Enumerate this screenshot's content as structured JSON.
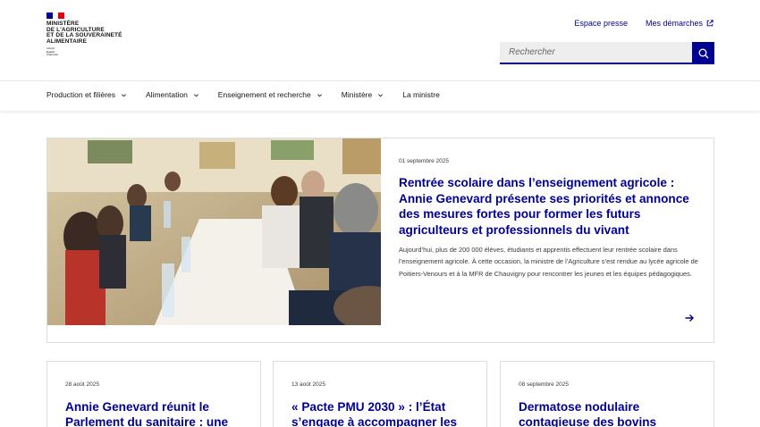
{
  "header": {
    "logo_lines": [
      "Ministère",
      "de l'Agriculture",
      "et de la Souveraineté",
      "alimentaire"
    ],
    "motto": [
      "Liberté",
      "Égalité",
      "Fraternité"
    ],
    "links": [
      "Espace presse",
      "Mes démarches"
    ],
    "search_placeholder": "Rechercher"
  },
  "nav": {
    "items": [
      {
        "label": "Production et filières",
        "dropdown": true
      },
      {
        "label": "Alimentation",
        "dropdown": true
      },
      {
        "label": "Enseignement et recherche",
        "dropdown": true
      },
      {
        "label": "Ministère",
        "dropdown": true
      },
      {
        "label": "La ministre",
        "dropdown": false
      }
    ]
  },
  "featured": {
    "date": "01 septembre 2025",
    "title": "Rentrée scolaire dans l’enseignement agricole : Annie Genevard présente ses priorités et annonce des mesures fortes pour former les futurs agriculteurs et professionnels du vivant",
    "description": "Aujourd’hui, plus de 200 000 élèves, étudiants et apprentis effectuent leur rentrée scolaire dans l’enseignement agricole. À cette occasion, la ministre de l’Agriculture s’est rendue au lycée agricole de Poitiers-Venours et à la MFR de Chauvigny pour rencontrer les jeunes et les équipes pédagogiques."
  },
  "cards": [
    {
      "date": "28 août 2025",
      "title": "Annie Genevard réunit le Parlement du sanitaire : une"
    },
    {
      "date": "13 août 2025",
      "title": "« Pacte PMU 2030 » : l’État s’engage à accompagner les"
    },
    {
      "date": "08 septembre 2025",
      "title": "Dermatose nodulaire contagieuse des bovins"
    }
  ],
  "colors": {
    "brand_blue": "#000091",
    "flag_red": "#e1000f"
  },
  "icons": {
    "search": "search-icon",
    "external": "external-link-icon",
    "arrow": "arrow-right-icon",
    "chevron": "chevron-down-icon"
  }
}
